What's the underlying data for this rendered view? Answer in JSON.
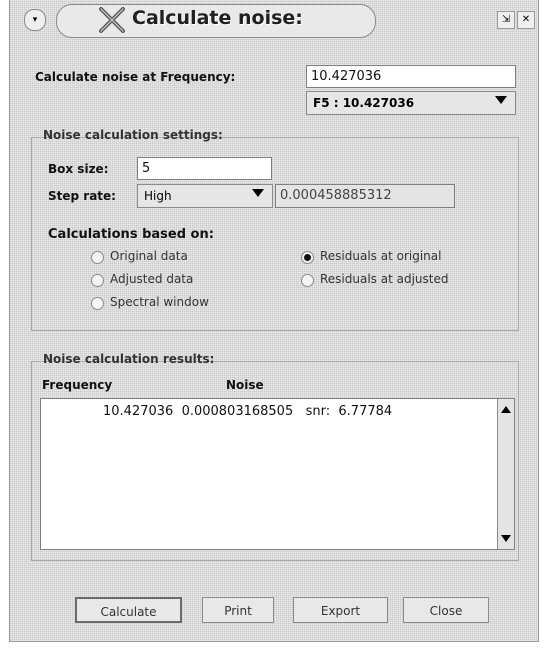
{
  "window": {
    "title": "Calculate noise:",
    "icon": "x-logo-icon",
    "system_menu_icon": "menu-icon",
    "shade_icon": "shade-icon",
    "close_icon": "close-icon"
  },
  "frequency": {
    "label": "Calculate noise at Frequency:",
    "value": "10.427036",
    "selected": "F5  : 10.427036"
  },
  "settings": {
    "title": "Noise calculation settings:",
    "box_size_label": "Box size:",
    "box_size_value": "5",
    "step_rate_label": "Step rate:",
    "step_rate_selected": "High",
    "step_rate_value": "0.000458885312",
    "based_on_title": "Calculations based on:",
    "options": [
      {
        "label": "Original data",
        "selected": false
      },
      {
        "label": "Residuals at original",
        "selected": true
      },
      {
        "label": "Adjusted data",
        "selected": false
      },
      {
        "label": "Residuals at adjusted",
        "selected": false
      },
      {
        "label": "Spectral window",
        "selected": false
      }
    ]
  },
  "results": {
    "title": "Noise calculation results:",
    "col_frequency": "Frequency",
    "col_noise": "Noise",
    "row_text": "10.427036  0.000803168505   snr:  6.77784"
  },
  "buttons": {
    "calculate": "Calculate",
    "print": "Print",
    "export": "Export",
    "close": "Close"
  }
}
